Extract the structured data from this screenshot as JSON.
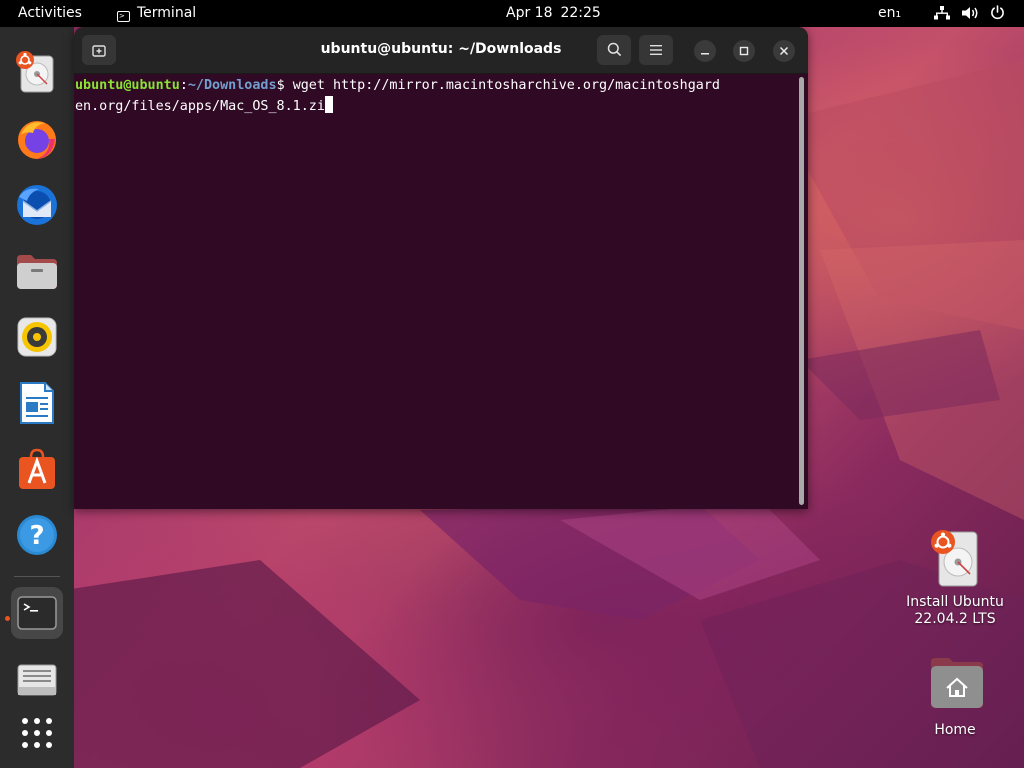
{
  "topbar": {
    "activities": "Activities",
    "app_name": "Terminal",
    "date": "Apr 18",
    "time": "22:25",
    "language": "en₁"
  },
  "dock": {
    "apps": [
      {
        "name": "Install Ubuntu",
        "icon": "ubuntu-installer-icon"
      },
      {
        "name": "Firefox",
        "icon": "firefox-icon"
      },
      {
        "name": "Thunderbird",
        "icon": "thunderbird-icon"
      },
      {
        "name": "Files",
        "icon": "files-icon"
      },
      {
        "name": "Rhythmbox",
        "icon": "rhythmbox-icon"
      },
      {
        "name": "LibreOffice Writer",
        "icon": "writer-icon"
      },
      {
        "name": "Ubuntu Software",
        "icon": "software-icon"
      },
      {
        "name": "Help",
        "icon": "help-icon"
      },
      {
        "name": "Terminal",
        "icon": "terminal-icon",
        "running": true
      },
      {
        "name": "Disks",
        "icon": "disk-icon"
      },
      {
        "name": "Show Applications",
        "icon": "app-grid-icon"
      }
    ]
  },
  "terminal": {
    "title": "ubuntu@ubuntu: ~/Downloads",
    "prompt_user": "ubuntu@ubuntu",
    "prompt_sep": ":",
    "prompt_path": "~/Downloads",
    "prompt_symbol": "$ ",
    "command_line1": "wget http://mirror.macintosharchive.org/macintoshgard",
    "command_line2": "en.org/files/apps/Mac_OS_8.1.zi"
  },
  "desktop": {
    "install_label_1": "Install Ubuntu",
    "install_label_2": "22.04.2 LTS",
    "home_label": "Home"
  },
  "colors": {
    "terminal_bg": "#300a24",
    "prompt_user": "#8ae234",
    "prompt_path": "#729fcf",
    "accent": "#e95420"
  }
}
